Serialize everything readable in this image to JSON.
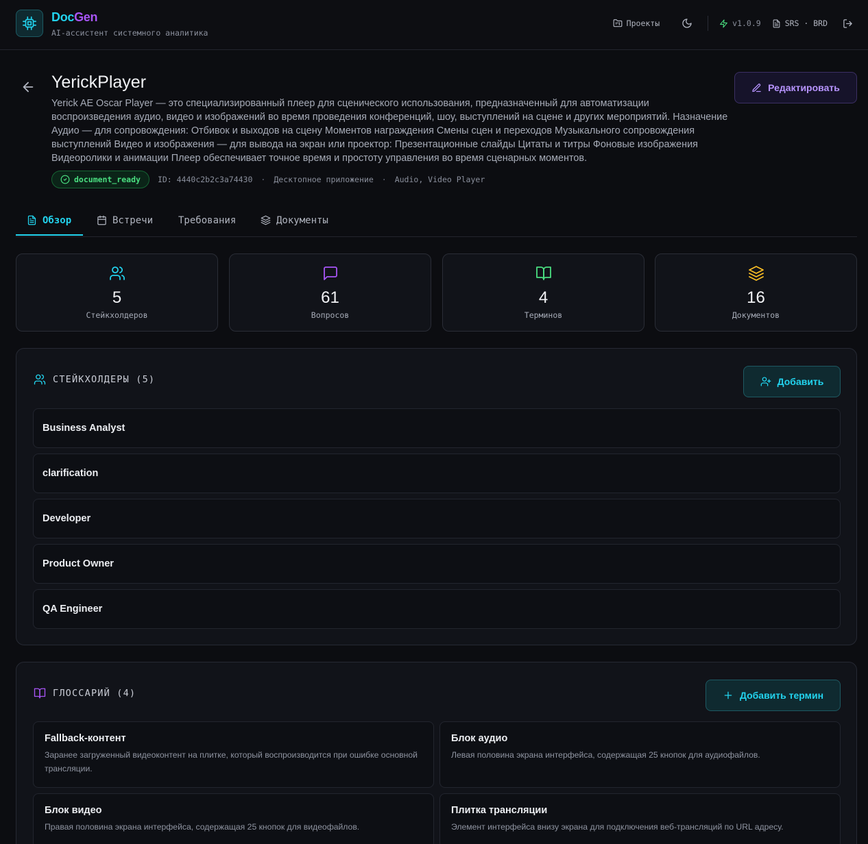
{
  "app": {
    "brand_part1": "Doc",
    "brand_part2": "Gen",
    "tagline": "AI-ассистент системного аналитика",
    "nav": {
      "projects_label": "Проекты",
      "version": "v1.0.9",
      "doc_types": "SRS · BRD"
    }
  },
  "project": {
    "title": "YerickPlayer",
    "description": "Yerick AE Oscar Player — это специализированный плеер для сценического использования, предназначенный для автоматизации воспроизведения аудио, видео и изображений во время проведения конференций, шоу, выступлений на сцене и других мероприятий. Назначение Аудио — для сопровождения: Отбивок и выходов на сцену Моментов награждения Смены сцен и переходов Музыкального сопровождения выступлений Видео и изображения — для вывода на экран или проектор: Презентационные слайды Цитаты и титры Фоновые изображения Видеоролики и анимации Плеер обеспечивает точное время и простоту управления во время сценарных моментов.",
    "edit_label": "Редактировать",
    "status": "document_ready",
    "id_text": "ID: 4440c2b2c3a74430",
    "type": "Десктопное приложение",
    "tags": "Audio, Video Player"
  },
  "tabs": [
    {
      "label": "Обзор"
    },
    {
      "label": "Встречи"
    },
    {
      "label": "Требования"
    },
    {
      "label": "Документы"
    }
  ],
  "stats": [
    {
      "value": "5",
      "label": "Стейкхолдеров",
      "color": "#22d3ee",
      "icon": "users-icon"
    },
    {
      "value": "61",
      "label": "Вопросов",
      "color": "#a855f7",
      "icon": "message-icon"
    },
    {
      "value": "4",
      "label": "Терминов",
      "color": "#4ade80",
      "icon": "book-icon"
    },
    {
      "value": "16",
      "label": "Документов",
      "color": "#fbbf24",
      "icon": "layers-icon"
    }
  ],
  "stakeholders": {
    "title": "СТЕЙКХОЛДЕРЫ (5)",
    "add_label": "Добавить",
    "items": [
      "Business Analyst",
      "clarification",
      "Developer",
      "Product Owner",
      "QA Engineer"
    ]
  },
  "glossary": {
    "title": "ГЛОССАРИЙ (4)",
    "add_label": "Добавить термин",
    "items": [
      {
        "name": "Fallback-контент",
        "desc": "Заранее загруженный видеоконтент на плитке, который воспроизводится при ошибке основной трансляции."
      },
      {
        "name": "Блок аудио",
        "desc": "Левая половина экрана интерфейса, содержащая 25 кнопок для аудиофайлов."
      },
      {
        "name": "Блок видео",
        "desc": "Правая половина экрана интерфейса, содержащая 25 кнопок для видеофайлов."
      },
      {
        "name": "Плитка трансляции",
        "desc": "Элемент интерфейса внизу экрана для подключения веб-трансляций по URL адресу."
      }
    ]
  },
  "colors": {
    "accent": "#22d3ee",
    "brand_secondary": "#a855f7",
    "success": "#4ade80",
    "warning": "#fbbf24"
  }
}
